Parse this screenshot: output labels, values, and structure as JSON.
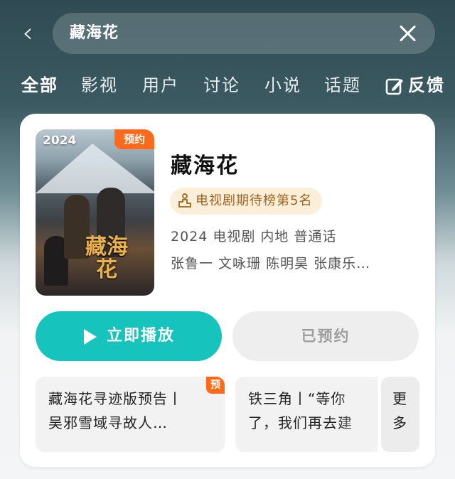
{
  "search": {
    "query": "藏海花"
  },
  "tabs": [
    "全部",
    "影视",
    "用户",
    "讨论",
    "小说",
    "话题"
  ],
  "feedback_label": "反馈",
  "result": {
    "poster_year": "2024",
    "poster_badge": "预约",
    "poster_art_title": "藏海花",
    "title": "藏海花",
    "rank_label": "电视剧期待榜第5名",
    "meta": "2024 电视剧 内地 普通话",
    "cast": "张鲁一 文咏珊 陈明昊 张康乐…",
    "play_label": "立即播放",
    "reserve_label": "已预约"
  },
  "clips": [
    {
      "line1": "藏海花寻迹版预告丨",
      "line2": "吴邪雪域寻故人…",
      "badge": "预"
    },
    {
      "line1": "铁三角丨“等你",
      "line2": "了，我们再去建"
    },
    {
      "line1": "更",
      "line2": "多"
    }
  ],
  "colors": {
    "accent": "#17c3bd",
    "badge": "#ff6a1a",
    "rank_bg": "#fbefd9",
    "rank_text": "#a0631d"
  }
}
